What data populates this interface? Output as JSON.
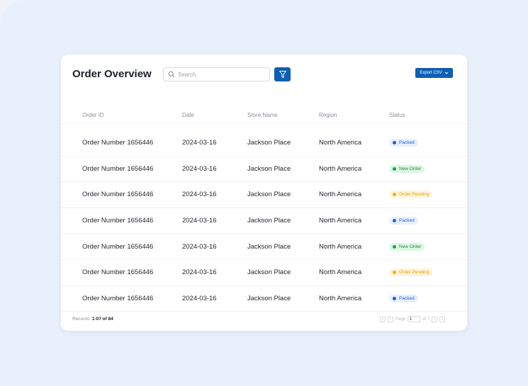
{
  "header": {
    "title": "Order Overview",
    "search_placeholder": "Search",
    "export_label": "Export CSV"
  },
  "table": {
    "columns": [
      "Order ID",
      "Date",
      "Store Name",
      "Region",
      "Status"
    ],
    "rows": [
      {
        "order_id": "Order Number 1656446",
        "date": "2024-03-16",
        "store": "Jackson Place",
        "region": "North America",
        "status": "Packed"
      },
      {
        "order_id": "Order Number 1656446",
        "date": "2024-03-16",
        "store": "Jackson Place",
        "region": "North America",
        "status": "New Order"
      },
      {
        "order_id": "Order Number 1656446",
        "date": "2024-03-16",
        "store": "Jackson Place",
        "region": "North America",
        "status": "Order Pending"
      },
      {
        "order_id": "Order Number 1656446",
        "date": "2024-03-16",
        "store": "Jackson Place",
        "region": "North America",
        "status": "Packed"
      },
      {
        "order_id": "Order Number 1656446",
        "date": "2024-03-16",
        "store": "Jackson Place",
        "region": "North America",
        "status": "New Order"
      },
      {
        "order_id": "Order Number 1656446",
        "date": "2024-03-16",
        "store": "Jackson Place",
        "region": "North America",
        "status": "Order Pending"
      },
      {
        "order_id": "Order Number 1656446",
        "date": "2024-03-16",
        "store": "Jackson Place",
        "region": "North America",
        "status": "Packed"
      }
    ]
  },
  "status_styles": {
    "Packed": {
      "bg": "#e6efff",
      "fg": "#1d5fd6",
      "dot": "#1d5fd6"
    },
    "New Order": {
      "bg": "#dcf8e4",
      "fg": "#1f8a45",
      "dot": "#22a04f"
    },
    "Order Pending": {
      "bg": "#fff4dc",
      "fg": "#e0a100",
      "dot": "#f0b400"
    }
  },
  "footer": {
    "records_label": "Records:",
    "records_value": "1-07 of 84",
    "page_label": "Page",
    "page_value": "1",
    "page_total": "of 7"
  },
  "icons": {
    "search": "search-icon",
    "filter": "filter-icon",
    "export_chevron": "chevron-down-icon"
  },
  "colors": {
    "accent": "#0d5fb3",
    "background": "#e8f0fb"
  }
}
